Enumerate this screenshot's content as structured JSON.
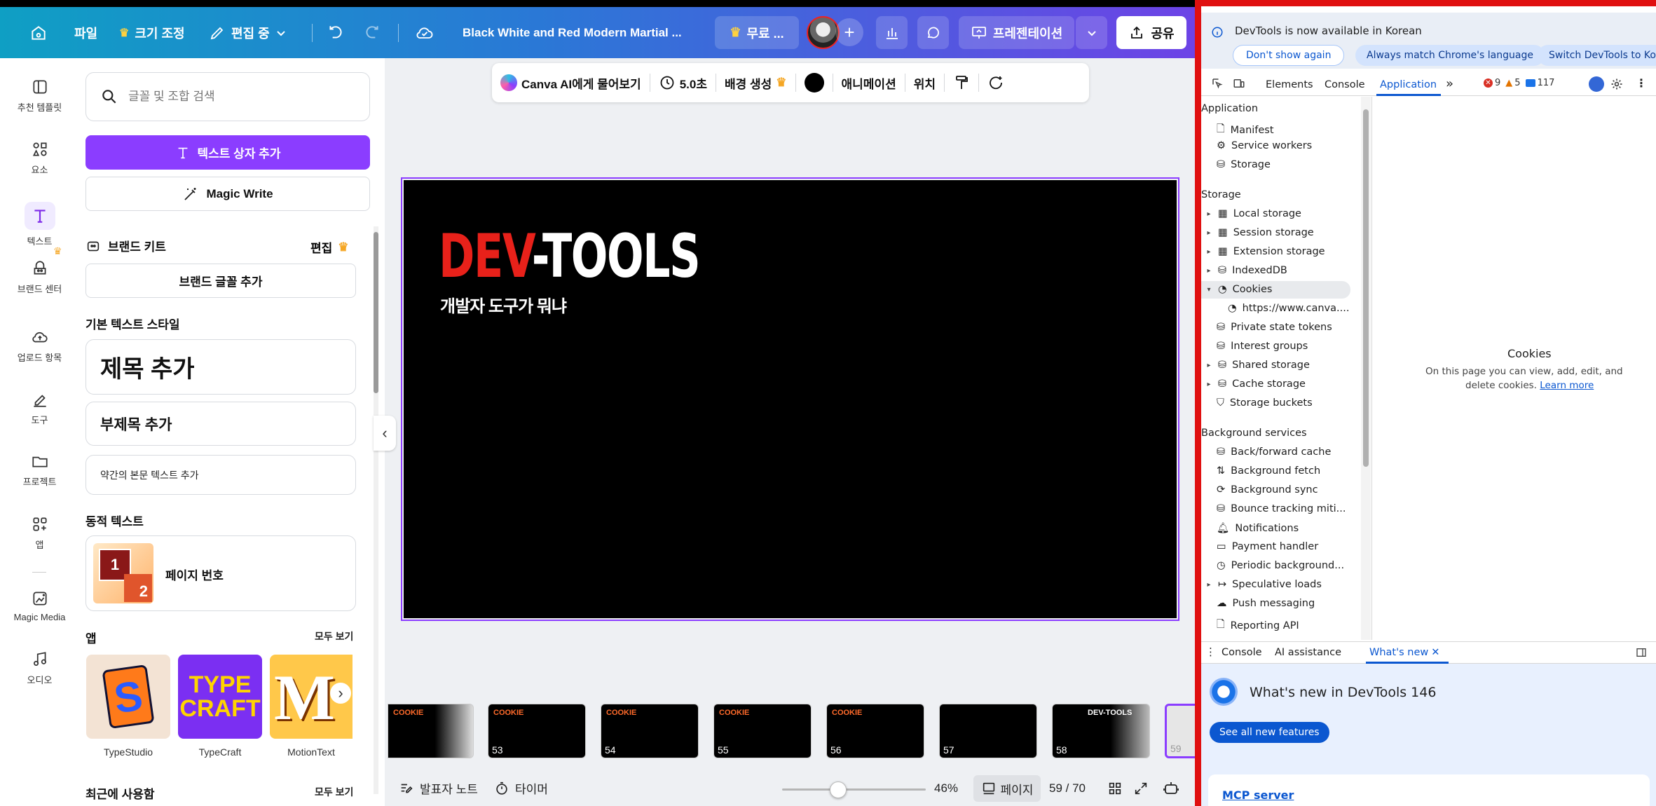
{
  "topbar": {
    "home_icon": "home-icon",
    "file": "파일",
    "resize": "크기 조정",
    "editing": "편집 중",
    "doc_title": "Black White and Red Modern Martial ...",
    "free": "무료 ...",
    "presentation": "프레젠테이션",
    "share": "공유"
  },
  "rail": [
    {
      "label": "추천 템플릿",
      "icon": "template-icon"
    },
    {
      "label": "요소",
      "icon": "elements-icon"
    },
    {
      "label": "텍스트",
      "icon": "text-icon"
    },
    {
      "label": "브랜드 센터",
      "icon": "brand-icon"
    },
    {
      "label": "업로드 항목",
      "icon": "upload-icon"
    },
    {
      "label": "도구",
      "icon": "draw-icon"
    },
    {
      "label": "프로젝트",
      "icon": "folder-icon"
    },
    {
      "label": "앱",
      "icon": "apps-icon"
    },
    {
      "label": "Magic Media",
      "icon": "magic-media-icon"
    },
    {
      "label": "오디오",
      "icon": "audio-icon"
    }
  ],
  "panel": {
    "search_placeholder": "글꼴 및 조합 검색",
    "add_textbox": "텍스트 상자 추가",
    "magic_write": "Magic Write",
    "brand_kit": "브랜드 키트",
    "brand_edit": "편집",
    "add_brand_font": "브랜드 글꼴 추가",
    "default_styles": "기본 텍스트 스타일",
    "add_heading": "제목 추가",
    "add_subheading": "부제목 추가",
    "add_body": "약간의 본문 텍스트 추가",
    "dynamic_text": "동적 텍스트",
    "page_number": "페이지 번호",
    "page_num_digits": [
      "1",
      "2"
    ],
    "apps": "앱",
    "see_all": "모두 보기",
    "app_items": [
      {
        "name": "TypeStudio",
        "mark": "S"
      },
      {
        "name": "TypeCraft",
        "mark": "TYPE CRAFT"
      },
      {
        "name": "MotionText",
        "mark": "M"
      }
    ],
    "recent": "최근에 사용함",
    "recent_see_all": "모두 보기"
  },
  "context_toolbar": {
    "ask_ai": "Canva AI에게 물어보기",
    "duration": "5.0초",
    "bg_generate": "배경 생성",
    "animation": "애니메이션",
    "position": "위치"
  },
  "slide": {
    "title_red": "DEV",
    "title_white": "-TOOLS",
    "subtitle": "개발자 도구가 뭐냐",
    "title_red_color": "#e8211a"
  },
  "thumbnails": [
    {
      "num": "",
      "title": "COOKIE"
    },
    {
      "num": "53",
      "title": "COOKIE"
    },
    {
      "num": "54",
      "title": "COOKIE"
    },
    {
      "num": "55",
      "title": "COOKIE"
    },
    {
      "num": "56",
      "title": "COOKIE"
    },
    {
      "num": "57",
      "title": ""
    },
    {
      "num": "58",
      "title": "DEV-TOOLS"
    },
    {
      "num": "59",
      "title": ""
    }
  ],
  "bottombar": {
    "notes": "발표자 노트",
    "timer": "타이머",
    "zoom": "46%",
    "zoom_fraction": 0.46,
    "pages": "페이지",
    "page_count": "59 / 70"
  },
  "devtools": {
    "banner": "DevTools is now available in Korean",
    "btn_dont_show": "Don't show again",
    "btn_match": "Always match Chrome's language",
    "btn_switch": "Switch DevTools to Kor",
    "tabs": [
      "Elements",
      "Console",
      "Application"
    ],
    "active_tab": "Application",
    "errors": "9",
    "warnings": "5",
    "messages": "117",
    "section_application": "Application",
    "app_items": [
      "Manifest",
      "Service workers",
      "Storage"
    ],
    "section_storage": "Storage",
    "storage_items": [
      "Local storage",
      "Session storage",
      "Extension storage",
      "IndexedDB",
      "Cookies",
      "https://www.canva....",
      "Private state tokens",
      "Interest groups",
      "Shared storage",
      "Cache storage",
      "Storage buckets"
    ],
    "section_bg": "Background services",
    "bg_items": [
      "Back/forward cache",
      "Background fetch",
      "Background sync",
      "Bounce tracking miti...",
      "Notifications",
      "Payment handler",
      "Periodic background...",
      "Speculative loads",
      "Push messaging",
      "Reporting API"
    ],
    "cookies_title": "Cookies",
    "cookies_desc_1": "On this page you can view, add, edit, and",
    "cookies_desc_2": "delete cookies.",
    "learn_more": "Learn more",
    "drawer_tabs": [
      "Console",
      "AI assistance",
      "What's new"
    ],
    "whats_new_title": "What's new in DevTools 146",
    "see_all_features": "See all new features",
    "mcp_server": "MCP server",
    "accent": "#0b57d0",
    "border_color": "#e01010"
  }
}
